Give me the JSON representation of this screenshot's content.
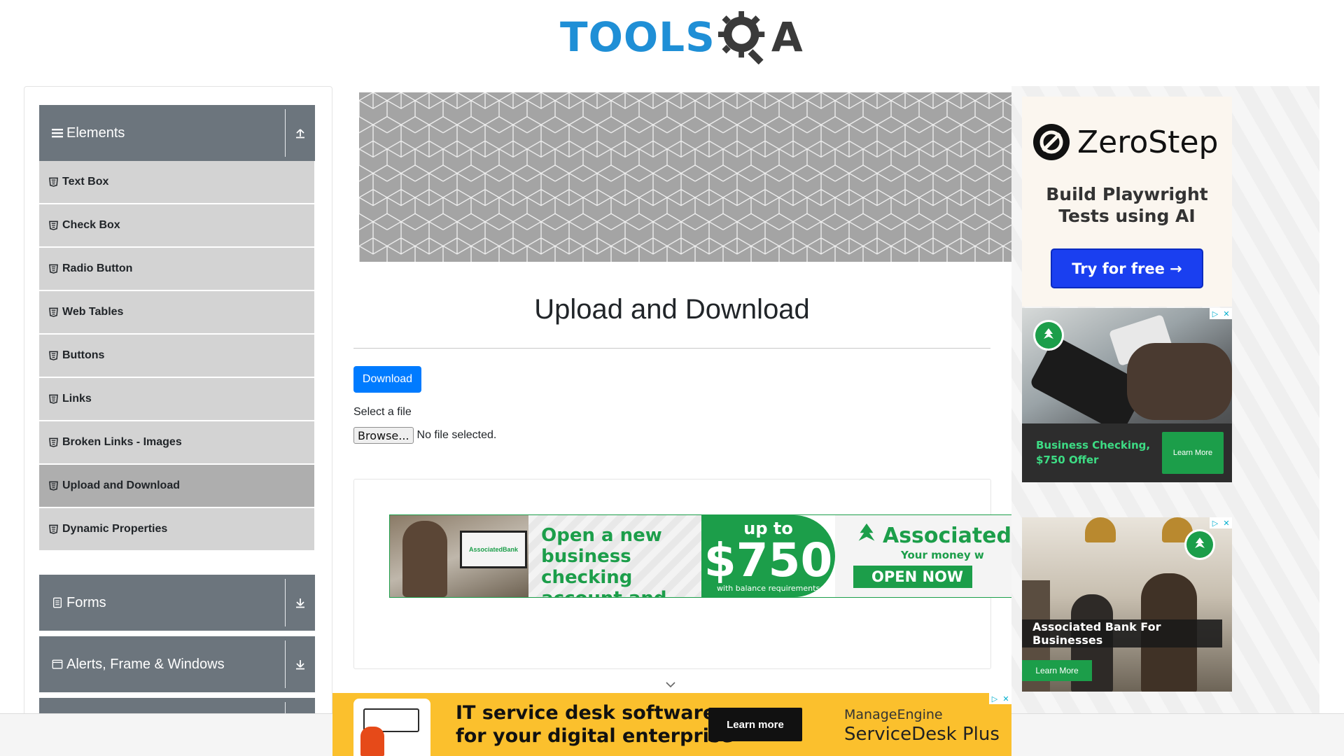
{
  "logo": {
    "part1": "TOOLS",
    "part2": "A"
  },
  "sidebar": {
    "groups": [
      {
        "label": "Elements",
        "icon": "hamburger-icon",
        "expanded": true
      },
      {
        "label": "Forms",
        "icon": "document-icon",
        "expanded": false
      },
      {
        "label": "Alerts, Frame & Windows",
        "icon": "window-icon",
        "expanded": false
      }
    ],
    "items": [
      {
        "label": "Text Box",
        "active": false
      },
      {
        "label": "Check Box",
        "active": false
      },
      {
        "label": "Radio Button",
        "active": false
      },
      {
        "label": "Web Tables",
        "active": false
      },
      {
        "label": "Buttons",
        "active": false
      },
      {
        "label": "Links",
        "active": false
      },
      {
        "label": "Broken Links - Images",
        "active": false
      },
      {
        "label": "Upload and Download",
        "active": true
      },
      {
        "label": "Dynamic Properties",
        "active": false
      }
    ]
  },
  "main": {
    "title": "Upload and Download",
    "download_label": "Download",
    "select_label": "Select a file",
    "browse_label": "Browse...",
    "file_status": "No file selected."
  },
  "ads": {
    "green": {
      "headline": [
        "Open a new",
        "business checking",
        "account and earn"
      ],
      "upto": "up to",
      "amount": "$750",
      "requirement": "with balance requirements",
      "brand": "Associated",
      "tagline": "Your money w",
      "cta": "OPEN NOW"
    },
    "zerostep": {
      "brand": "ZeroStep",
      "tagline": [
        "Build Playwright",
        "Tests using AI"
      ],
      "cta": "Try for free →"
    },
    "bank1": {
      "message": [
        "Business Checking,",
        "$750 Offer"
      ],
      "cta": "Learn More"
    },
    "bank2": {
      "label": "Associated Bank For Businesses",
      "cta": "Learn More"
    },
    "bottom": {
      "headline": [
        "IT service desk software",
        "for your digital enterprise"
      ],
      "cta": "Learn more",
      "brand1": "ManageEngine",
      "brand2": "ServiceDesk Plus"
    }
  },
  "colors": {
    "primary": "#007bff",
    "sidebar_header": "#6c757d",
    "menu_item": "#d3d3d3",
    "menu_active": "#aeaeae",
    "bank_green": "#1c9e4a",
    "bottom_ad": "#fbc02d"
  }
}
